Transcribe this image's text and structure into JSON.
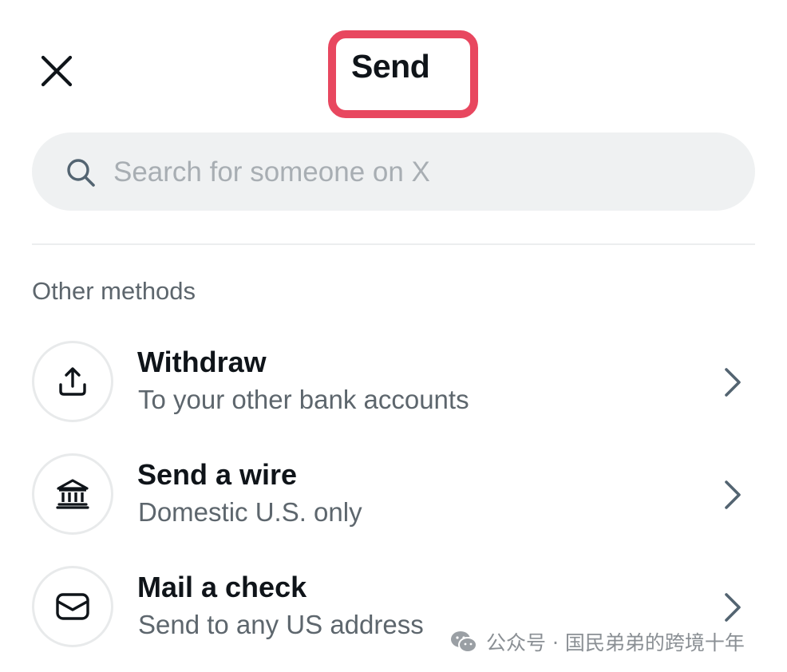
{
  "header": {
    "title": "Send",
    "close_icon": "close-icon",
    "highlight_color": "#e8475f"
  },
  "search": {
    "placeholder": "Search for someone on X",
    "value": "",
    "icon": "search-icon"
  },
  "other_methods": {
    "heading": "Other methods",
    "items": [
      {
        "label": "Withdraw",
        "sublabel": "To your other bank accounts",
        "icon": "upload-icon"
      },
      {
        "label": "Send a wire",
        "sublabel": "Domestic U.S. only",
        "icon": "bank-icon"
      },
      {
        "label": "Mail a check",
        "sublabel": "Send to any US address",
        "icon": "envelope-icon"
      }
    ]
  },
  "watermark": {
    "text": "公众号 · 国民弟弟的跨境十年",
    "icon": "wechat-icon"
  }
}
